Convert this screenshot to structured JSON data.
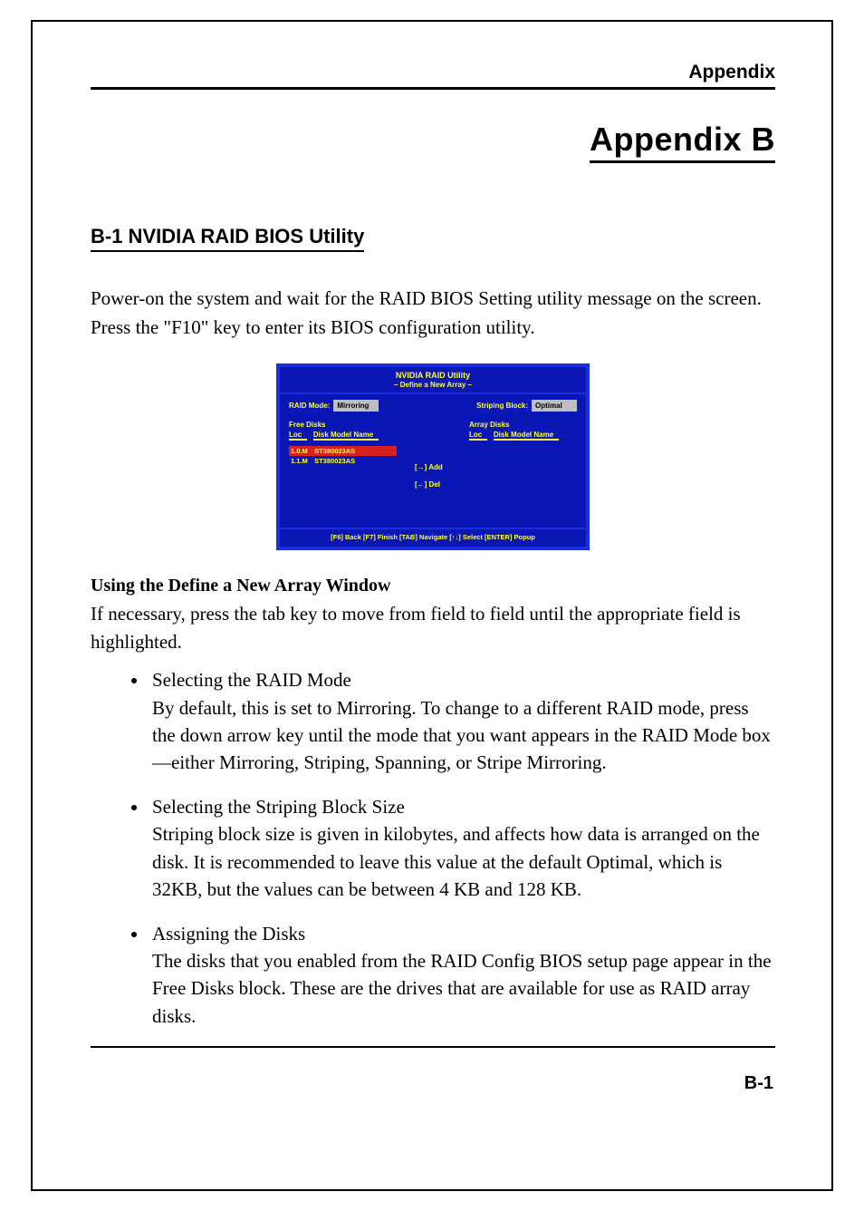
{
  "header": {
    "label": "Appendix"
  },
  "chapter": {
    "title": "Appendix B"
  },
  "section": {
    "heading": "B-1 NVIDIA RAID BIOS Utility"
  },
  "intro": "Power-on the system and wait for the RAID BIOS Setting utility message on the screen. Press the \"F10\" key to enter its BIOS configuration utility.",
  "bios": {
    "title": "NVIDIA RAID Utility",
    "subtitle": "– Define a New Array –",
    "raid_mode_label": "RAID Mode:",
    "raid_mode_value": "Mirroring",
    "striping_label": "Striping Block:",
    "striping_value": "Optimal",
    "free_disks_label": "Free Disks",
    "array_disks_label": "Array Disks",
    "col_loc": "Loc",
    "col_model": "Disk Model Name",
    "free_disks": [
      {
        "loc": "1.0.M",
        "model": "ST380023AS",
        "selected": true
      },
      {
        "loc": "1.1.M",
        "model": "ST380023AS",
        "selected": false
      }
    ],
    "array_disks": [],
    "add_label": "[→] Add",
    "del_label": "[←] Del",
    "footer": "[F6] Back  [F7] Finish  [TAB] Navigate  [↑↓] Select  [ENTER] Popup"
  },
  "subsection": {
    "title": "Using the Define a New Array Window",
    "lead": "If necessary, press the tab key to move from field to field until the appropriate field is highlighted.",
    "items": [
      {
        "title": "Selecting the RAID Mode",
        "body": "By default, this is set to Mirroring. To change to a different RAID mode, press the down arrow key until the mode that you want appears in the RAID Mode box—either Mirroring, Striping, Spanning, or Stripe Mirroring."
      },
      {
        "title": "Selecting the Striping Block Size",
        "body": "Striping block size is given in kilobytes, and affects how data is arranged on the disk. It is recommended to leave this value at the default Optimal, which is 32KB, but the values can be between 4 KB and 128 KB."
      },
      {
        "title": "Assigning the Disks",
        "body": "The disks that you enabled from the RAID Config BIOS setup page appear in the Free Disks block. These are the drives that are available for use as RAID array disks."
      }
    ]
  },
  "footer": {
    "page": "B-1"
  }
}
